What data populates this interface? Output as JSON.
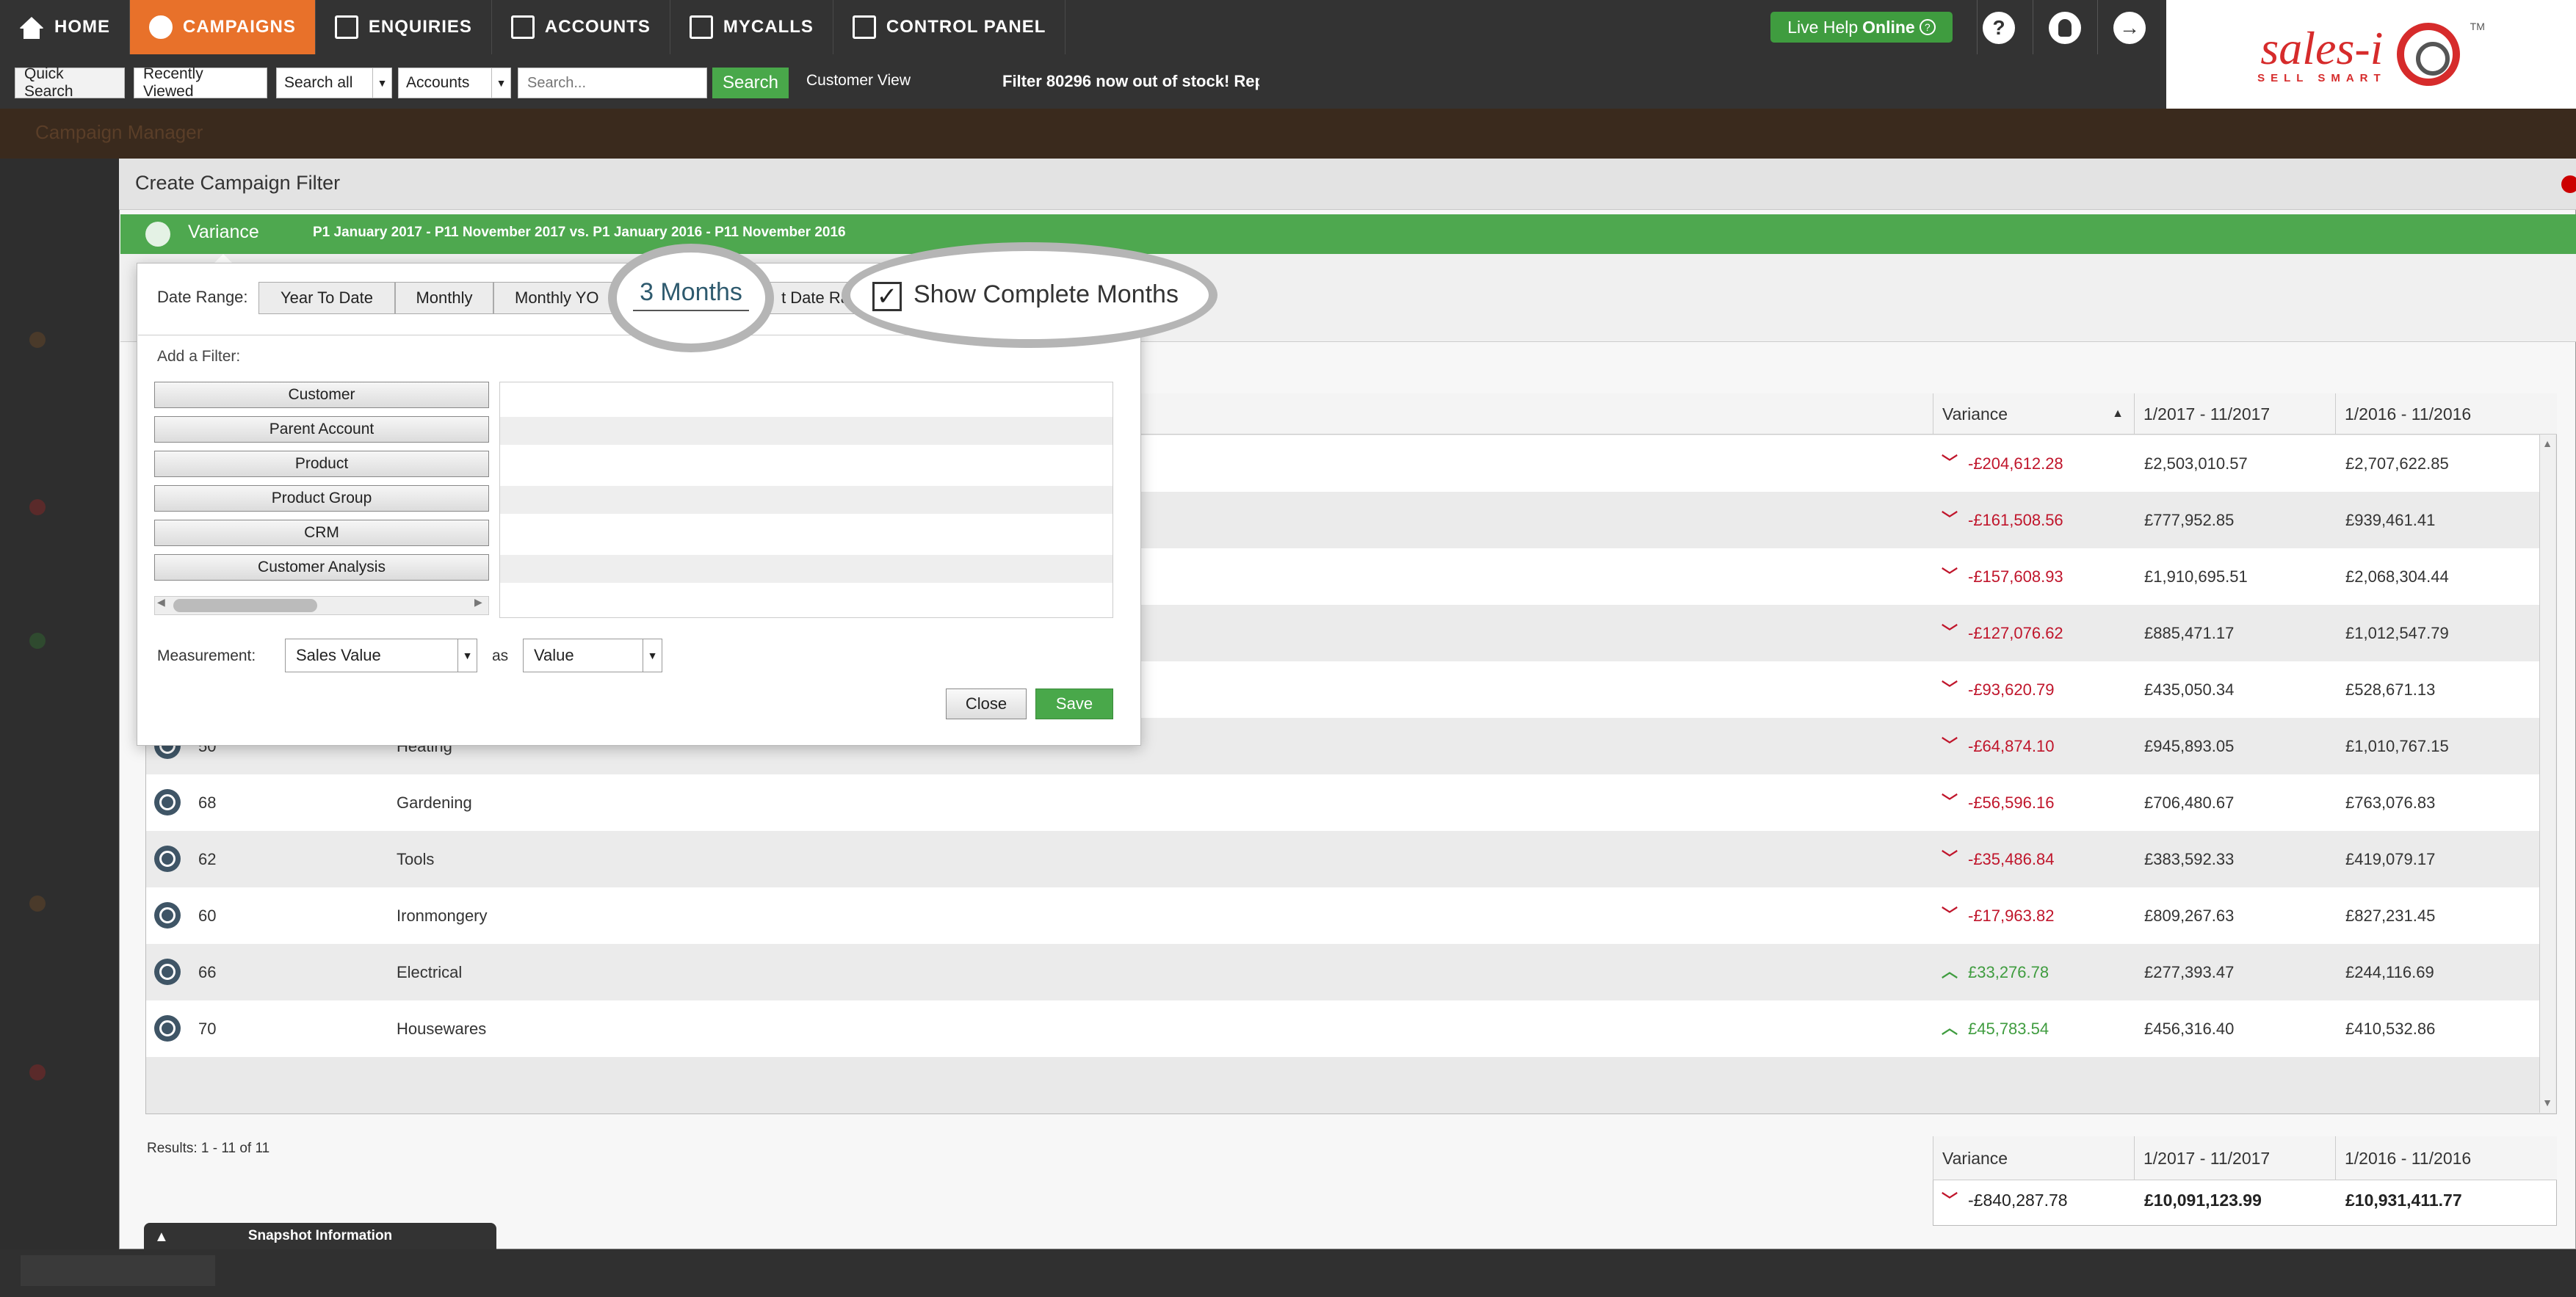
{
  "nav": {
    "items": [
      {
        "label": "HOME",
        "icon": "home-icon"
      },
      {
        "label": "CAMPAIGNS",
        "icon": "campaigns-icon",
        "active": true
      },
      {
        "label": "ENQUIRIES",
        "icon": "enquiries-icon"
      },
      {
        "label": "ACCOUNTS",
        "icon": "accounts-icon"
      },
      {
        "label": "MYCALLS",
        "icon": "mycalls-icon"
      },
      {
        "label": "CONTROL PANEL",
        "icon": "control-panel-icon"
      }
    ],
    "live_help": "Live Help",
    "live_help_status": "Online",
    "help_glyph": "?",
    "logout_glyph": "→"
  },
  "logo": {
    "main": "sales-i",
    "tagline": "SELL SMART",
    "tm": "TM"
  },
  "toolbar": {
    "quick_search": "Quick Search",
    "recently_viewed": "Recently Viewed",
    "search_all": "Search all",
    "accounts": "Accounts",
    "search_placeholder": "Search...",
    "search_button": "Search",
    "customer_view": "Customer View",
    "ticker": "Filter 80296 now out of stock! Repl"
  },
  "background": {
    "strip_text": "Campaign Manager"
  },
  "modal": {
    "title": "Create Campaign Filter",
    "tab": "Variance",
    "period": "P1 January 2017 - P11 November 2017 vs. P1 January 2016 - P11 November 2016"
  },
  "popup": {
    "date_range_label": "Date Range:",
    "date_buttons": [
      "Year To Date",
      "Monthly",
      "Monthly YO",
      "3 Months",
      "t Date Ra"
    ],
    "show_complete_months": "Show Complete Months",
    "show_complete_months_checked": true,
    "add_filter_label": "Add a Filter:",
    "filters": [
      "Customer",
      "Parent Account",
      "Product",
      "Product Group",
      "CRM",
      "Customer Analysis"
    ],
    "measurement_label": "Measurement:",
    "measurement_value": "Sales Value",
    "as_label": "as",
    "as_value": "Value",
    "close": "Close",
    "save": "Save"
  },
  "table": {
    "headers": {
      "variance": "Variance",
      "current": "1/2017 - 11/2017",
      "previous": "1/2016 - 11/2016"
    },
    "sort_indicator": "▲",
    "rows": [
      {
        "code": "",
        "name": "",
        "variance": "-£204,612.28",
        "current": "£2,503,010.57",
        "previous": "£2,707,622.85",
        "dir": "down"
      },
      {
        "code": "",
        "name": "",
        "variance": "-£161,508.56",
        "current": "£777,952.85",
        "previous": "£939,461.41",
        "dir": "down"
      },
      {
        "code": "",
        "name": "",
        "variance": "-£157,608.93",
        "current": "£1,910,695.51",
        "previous": "£2,068,304.44",
        "dir": "down"
      },
      {
        "code": "",
        "name": "",
        "variance": "-£127,076.62",
        "current": "£885,471.17",
        "previous": "£1,012,547.79",
        "dir": "down"
      },
      {
        "code": "",
        "name": "",
        "variance": "-£93,620.79",
        "current": "£435,050.34",
        "previous": "£528,671.13",
        "dir": "down"
      },
      {
        "code": "50",
        "name": "Heating",
        "variance": "-£64,874.10",
        "current": "£945,893.05",
        "previous": "£1,010,767.15",
        "dir": "down"
      },
      {
        "code": "68",
        "name": "Gardening",
        "variance": "-£56,596.16",
        "current": "£706,480.67",
        "previous": "£763,076.83",
        "dir": "down"
      },
      {
        "code": "62",
        "name": "Tools",
        "variance": "-£35,486.84",
        "current": "£383,592.33",
        "previous": "£419,079.17",
        "dir": "down"
      },
      {
        "code": "60",
        "name": "Ironmongery",
        "variance": "-£17,963.82",
        "current": "£809,267.63",
        "previous": "£827,231.45",
        "dir": "down"
      },
      {
        "code": "66",
        "name": "Electrical",
        "variance": "£33,276.78",
        "current": "£277,393.47",
        "previous": "£244,116.69",
        "dir": "up"
      },
      {
        "code": "70",
        "name": "Housewares",
        "variance": "£45,783.54",
        "current": "£456,316.40",
        "previous": "£410,532.86",
        "dir": "up"
      }
    ],
    "results": "Results: 1 - 11 of 11"
  },
  "summary": {
    "headers": {
      "variance": "Variance",
      "current": "1/2017 - 11/2017",
      "previous": "1/2016 - 11/2016"
    },
    "variance": "-£840,287.78",
    "current": "£10,091,123.99",
    "previous": "£10,931,411.77"
  },
  "snapshot": {
    "label": "Snapshot Information"
  },
  "colors": {
    "accent": "#e8712a",
    "green": "#4ea84f",
    "negative": "#c0152b",
    "positive": "#3f9c3f"
  }
}
